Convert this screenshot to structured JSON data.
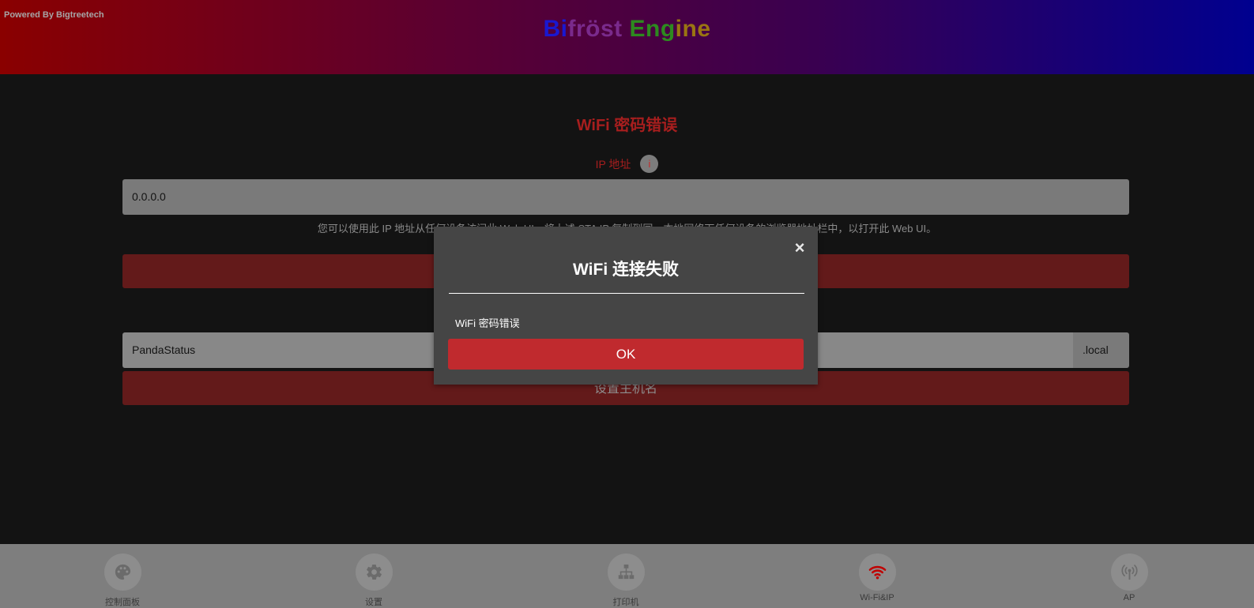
{
  "header": {
    "powered_by": "Powered By Bigtreetech",
    "brand_part1": "Bi",
    "brand_part2": "fröst ",
    "brand_part3": "Eng",
    "brand_part4": "ine"
  },
  "main": {
    "status_title": "WiFi 密码错误",
    "ip_label": "IP 地址",
    "info_icon_glyph": "i",
    "ip_value": "0.0.0.0",
    "ip_help": "您可以使用此 IP 地址从任何设备访问此 Web UI。将上述 STA IP 复制到同一本地网络下任何设备的浏览器地址栏中，以打开此 Web UI。",
    "hostname_value": "PandaStatus",
    "hostname_suffix": ".local",
    "set_hostname_label": "设置主机名"
  },
  "modal": {
    "title": "WiFi 连接失败",
    "close_glyph": "×",
    "message": "WiFi 密码错误",
    "ok_label": "OK"
  },
  "bottom_nav": {
    "items": [
      {
        "label": "控制面板",
        "icon": "palette-icon"
      },
      {
        "label": "设置",
        "icon": "gear-icon"
      },
      {
        "label": "打印机",
        "icon": "sitemap-icon"
      },
      {
        "label": "Wi-Fi&IP",
        "icon": "wifi-icon"
      },
      {
        "label": "AP",
        "icon": "broadcast-icon"
      }
    ]
  },
  "colors": {
    "accent_red": "#c02a2e",
    "active_icon": "#c00000",
    "inactive_icon": "#6b6b6b"
  }
}
